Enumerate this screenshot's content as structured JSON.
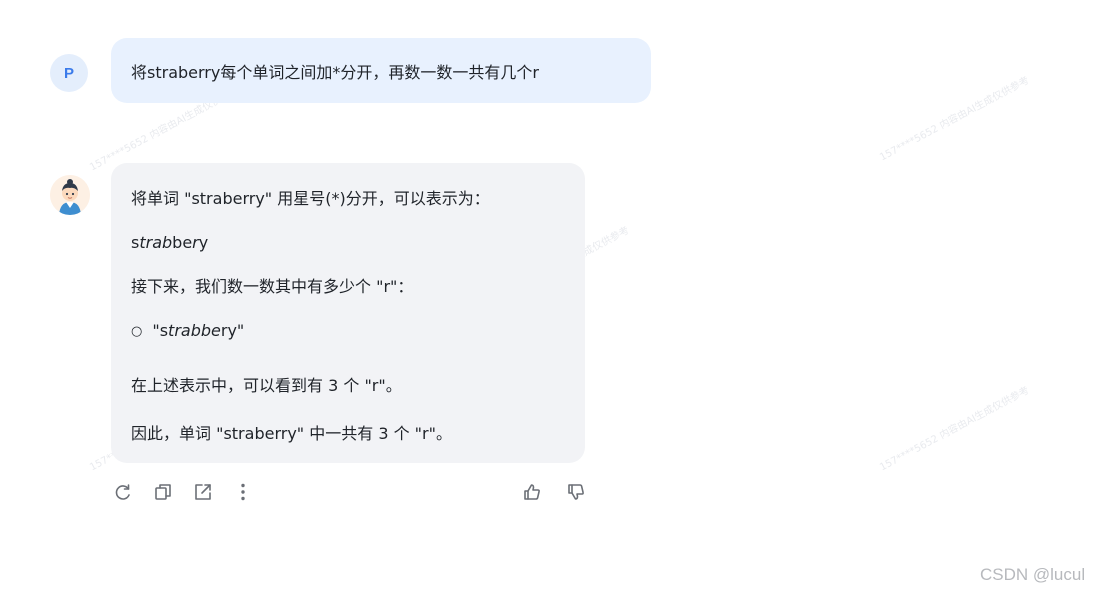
{
  "user_message": {
    "avatar_letter": "P",
    "text": "将straberry每个单词之间加*分开，再数一数一共有几个r"
  },
  "bot_message": {
    "line1": "将单词 \"straberry\" 用星号(*)分开，可以表示为：",
    "line2_a": "s",
    "line2_b": "trab",
    "line2_c": "be",
    "line2_d": "r",
    "line2_e": "y",
    "line3": "接下来，我们数一数其中有多少个 \"r\"：",
    "bullet_symbol": "○",
    "bullet_open": "\"s",
    "bullet_b": "trab",
    "bullet_c": "be",
    "bullet_d": "r",
    "bullet_e": "y\"",
    "line5": "在上述表示中，可以看到有 3 个 \"r\"。",
    "line6": "因此，单词 \"straberry\" 中一共有 3 个 \"r\"。"
  },
  "actions": {
    "left": [
      "refresh-icon",
      "copy-icon",
      "share-icon",
      "more-icon"
    ],
    "right": [
      "thumbs-up-icon",
      "thumbs-down-icon"
    ]
  },
  "watermark": {
    "corner_text": "CSDN @lucul"
  },
  "colors": {
    "user_bubble": "#e8f1fe",
    "bot_bubble": "#f2f3f6",
    "avatar_text": "#3b7bea",
    "icon": "#6b6f76"
  }
}
